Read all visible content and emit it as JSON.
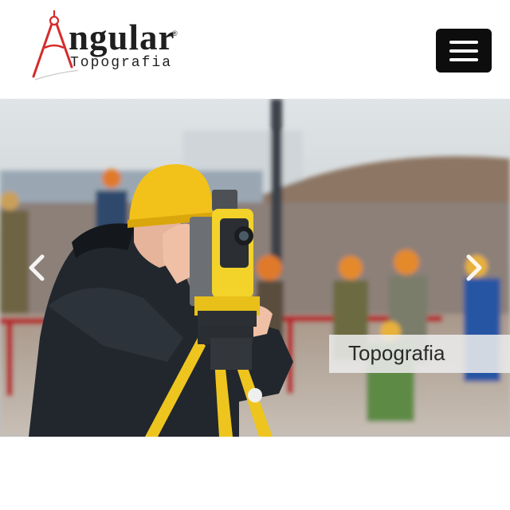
{
  "brand": {
    "name": "ngular",
    "registered_mark": "®",
    "subtitle": "Topografia",
    "accent_color": "#d62b2b",
    "logo_icon": "compass-a-icon"
  },
  "header": {
    "menu_icon": "hamburger-menu-icon"
  },
  "carousel": {
    "slide_caption": "Topografia",
    "prev_icon": "chevron-left-icon",
    "next_icon": "chevron-right-icon"
  }
}
